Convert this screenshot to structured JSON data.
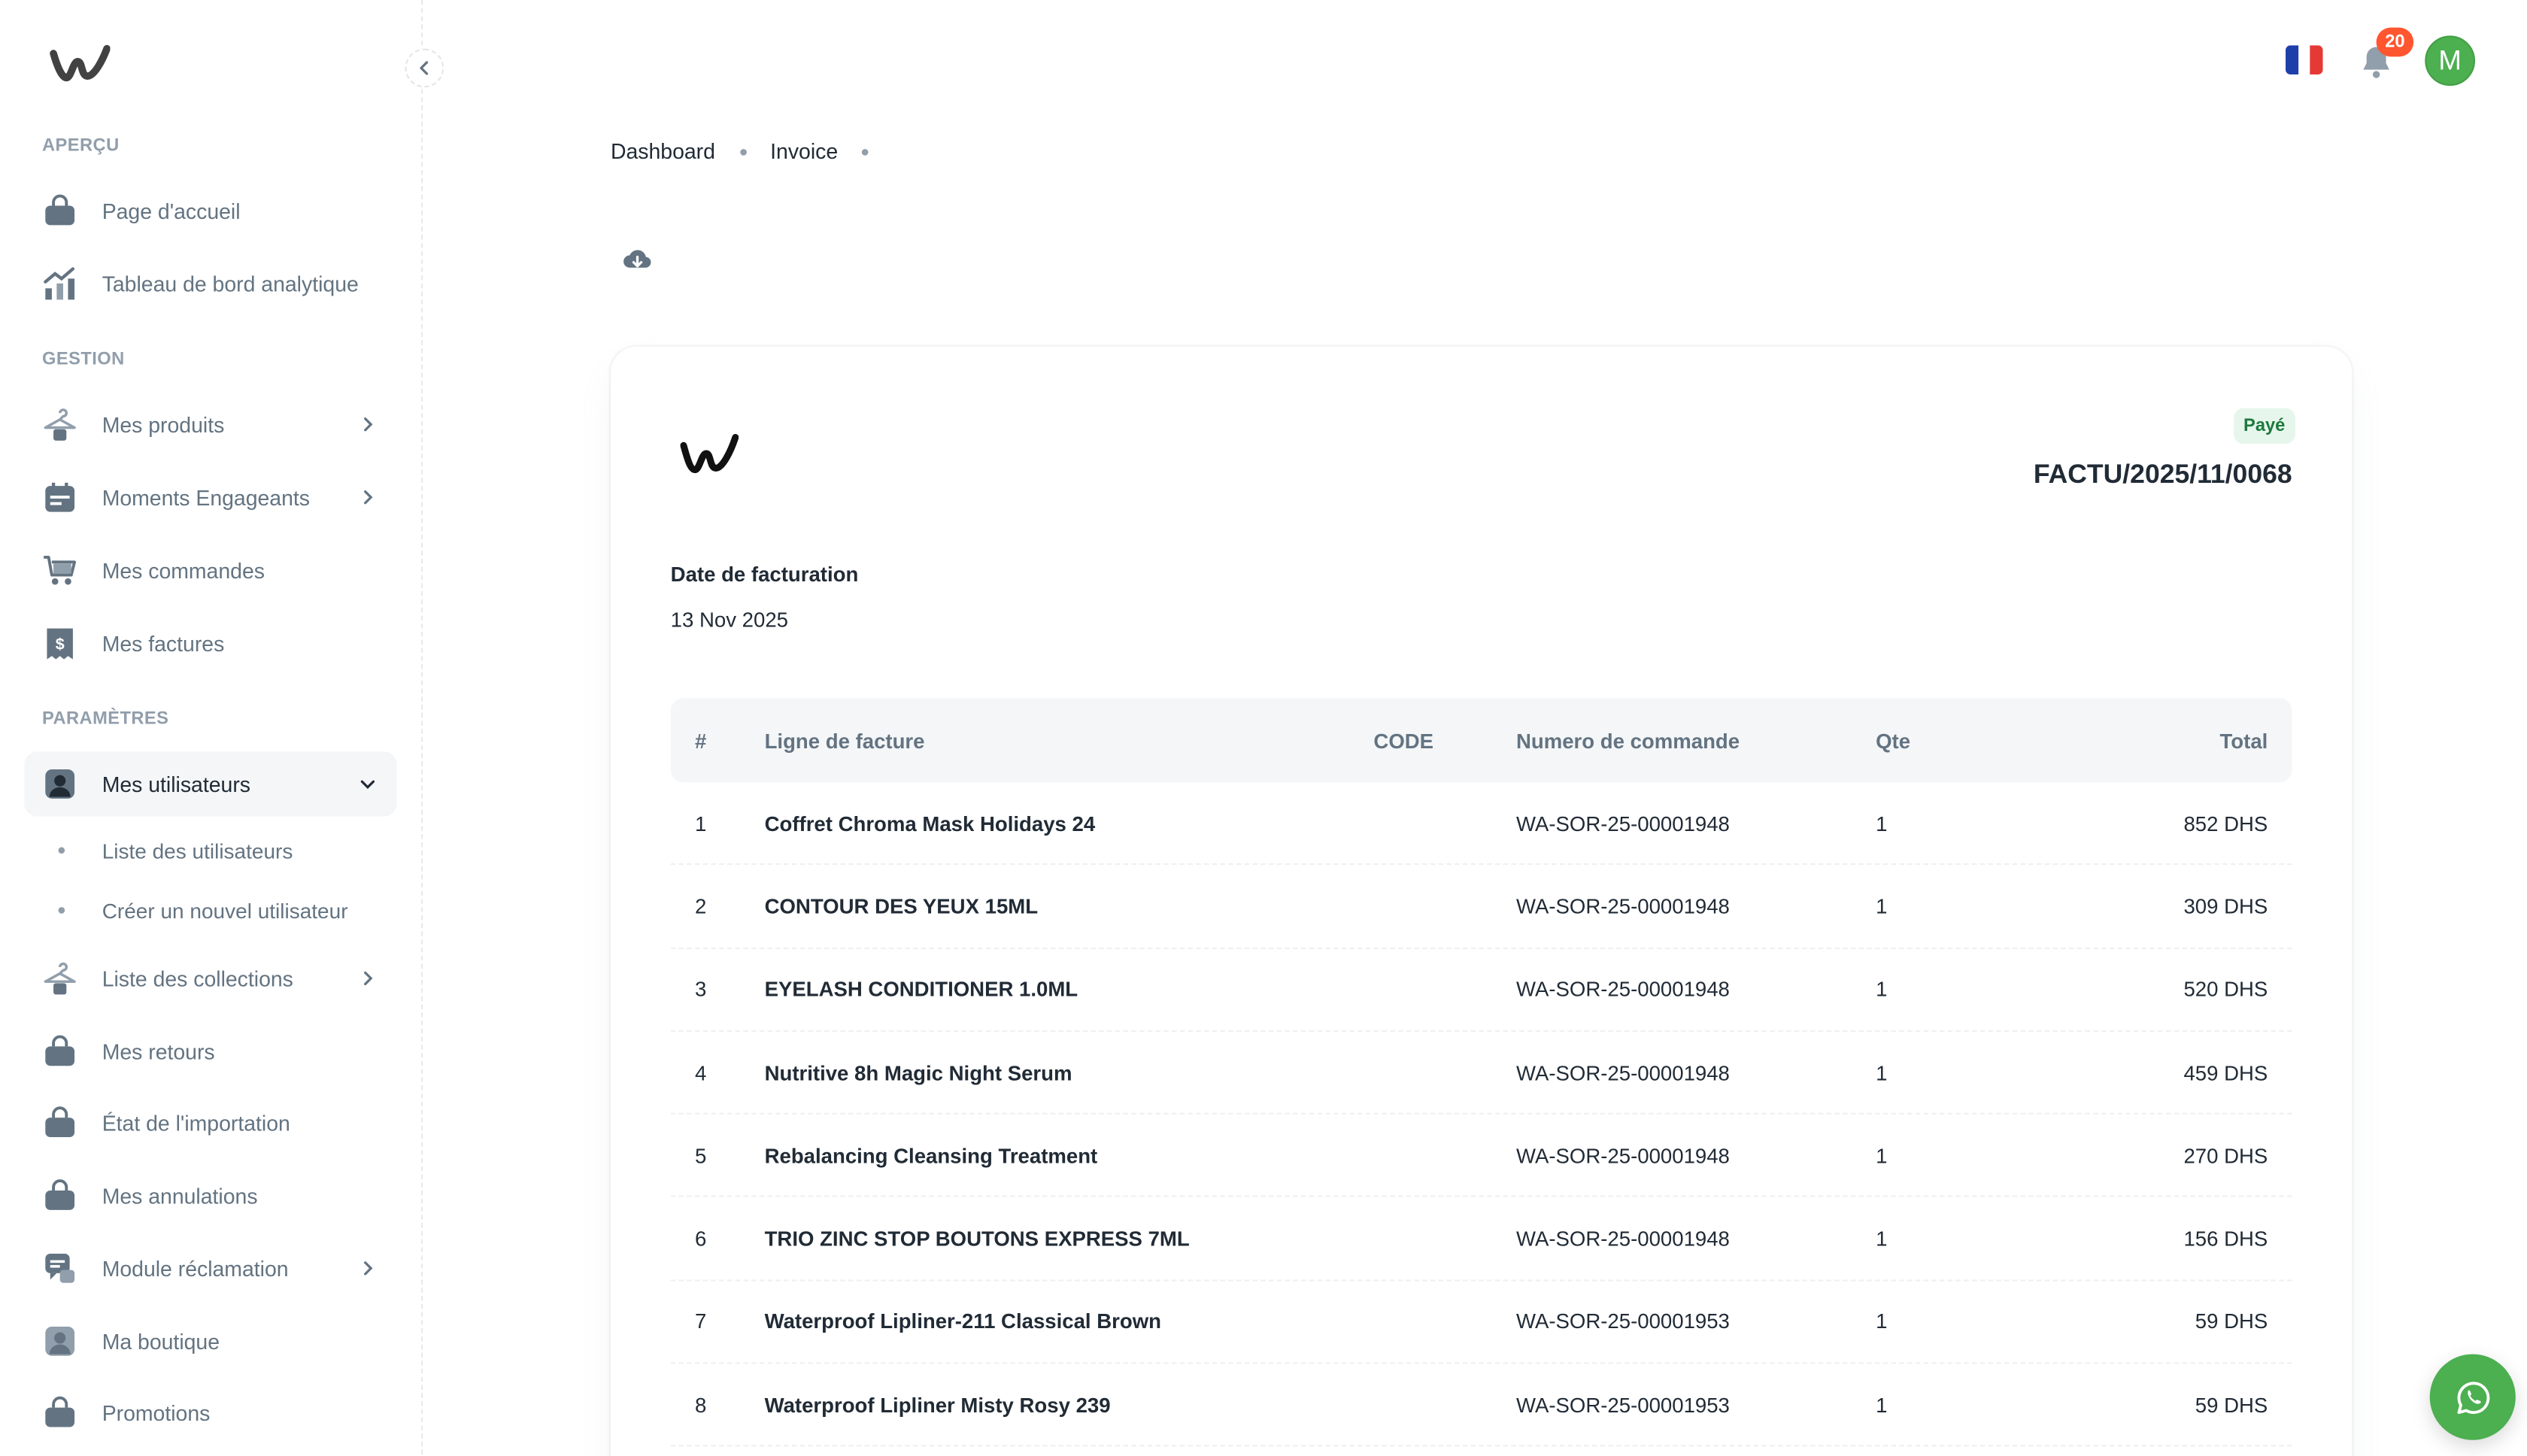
{
  "sidebar": {
    "sections": {
      "overview": "APERÇU",
      "management": "GESTION",
      "settings": "PARAMÈTRES"
    },
    "items": {
      "home": "Page d'accueil",
      "analytics": "Tableau de bord analytique",
      "products": "Mes produits",
      "moments": "Moments Engageants",
      "orders": "Mes commandes",
      "invoices": "Mes factures",
      "users": "Mes utilisateurs",
      "users_list": "Liste des utilisateurs",
      "users_create": "Créer un nouvel utilisateur",
      "collections": "Liste des collections",
      "returns": "Mes retours",
      "import_status": "État de l'importation",
      "cancellations": "Mes annulations",
      "claims": "Module réclamation",
      "shop": "Ma boutique",
      "promotions": "Promotions"
    }
  },
  "header": {
    "notification_count": "20",
    "avatar_letter": "M",
    "flag_colors": [
      "#1f3fa8",
      "#ffffff",
      "#e53935"
    ]
  },
  "breadcrumb": {
    "items": [
      "Dashboard",
      "Invoice"
    ]
  },
  "invoice": {
    "status": "Payé",
    "number": "FACTU/2025/11/0068",
    "date_label": "Date de facturation",
    "date_value": "13 Nov 2025",
    "columns": {
      "num": "#",
      "line": "Ligne de facture",
      "code": "CODE",
      "order": "Numero de commande",
      "qty": "Qte",
      "total": "Total"
    },
    "rows": [
      {
        "num": "1",
        "line": "Coffret Chroma Mask Holidays 24",
        "code": "",
        "order": "WA-SOR-25-00001948",
        "qty": "1",
        "total": "852 DHS"
      },
      {
        "num": "2",
        "line": "CONTOUR DES YEUX 15ML",
        "code": "",
        "order": "WA-SOR-25-00001948",
        "qty": "1",
        "total": "309 DHS"
      },
      {
        "num": "3",
        "line": "EYELASH CONDITIONER 1.0ML",
        "code": "",
        "order": "WA-SOR-25-00001948",
        "qty": "1",
        "total": "520 DHS"
      },
      {
        "num": "4",
        "line": "Nutritive 8h Magic Night Serum",
        "code": "",
        "order": "WA-SOR-25-00001948",
        "qty": "1",
        "total": "459 DHS"
      },
      {
        "num": "5",
        "line": "Rebalancing Cleansing Treatment",
        "code": "",
        "order": "WA-SOR-25-00001948",
        "qty": "1",
        "total": "270 DHS"
      },
      {
        "num": "6",
        "line": "TRIO ZINC STOP BOUTONS EXPRESS 7ML",
        "code": "",
        "order": "WA-SOR-25-00001948",
        "qty": "1",
        "total": "156 DHS"
      },
      {
        "num": "7",
        "line": "Waterproof Lipliner-211 Classical Brown",
        "code": "",
        "order": "WA-SOR-25-00001953",
        "qty": "1",
        "total": "59 DHS"
      },
      {
        "num": "8",
        "line": "Waterproof Lipliner Misty Rosy 239",
        "code": "",
        "order": "WA-SOR-25-00001953",
        "qty": "1",
        "total": "59 DHS"
      }
    ]
  },
  "colors": {
    "accent_green": "#4caf50",
    "badge_red": "#ff5630",
    "status_bg": "#e7f6ec",
    "status_text": "#1b7a3d"
  }
}
